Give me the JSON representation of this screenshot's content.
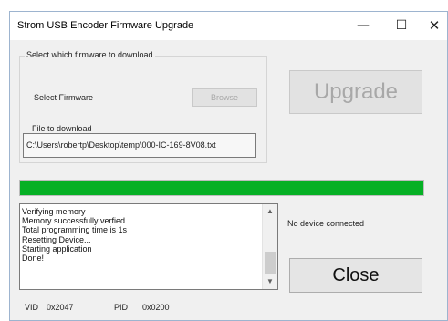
{
  "window": {
    "title": "Strom USB Encoder Firmware Upgrade",
    "controls": {
      "minimize": "—",
      "maximize": "☐",
      "close": "✕"
    }
  },
  "firmware_group": {
    "legend": "Select which firmware to download",
    "select_label": "Select Firmware",
    "browse_button": "Browse",
    "file_legend": "File to download",
    "file_path": "C:\\Users\\robertp\\Desktop\\temp\\000-IC-169-8V08.txt"
  },
  "upgrade_button": "Upgrade",
  "progress": {
    "value": 1.0,
    "color": "#06b025"
  },
  "log": {
    "lines": [
      "Verifying memory",
      "Memory successfully verfied",
      "Total programming time is 1s",
      "Resetting Device...",
      "Starting application",
      "Done!"
    ]
  },
  "device_status": "No device connected",
  "close_button": "Close",
  "ids": {
    "vid_label": "VID",
    "vid_value": "0x2047",
    "pid_label": "PID",
    "pid_value": "0x0200"
  }
}
